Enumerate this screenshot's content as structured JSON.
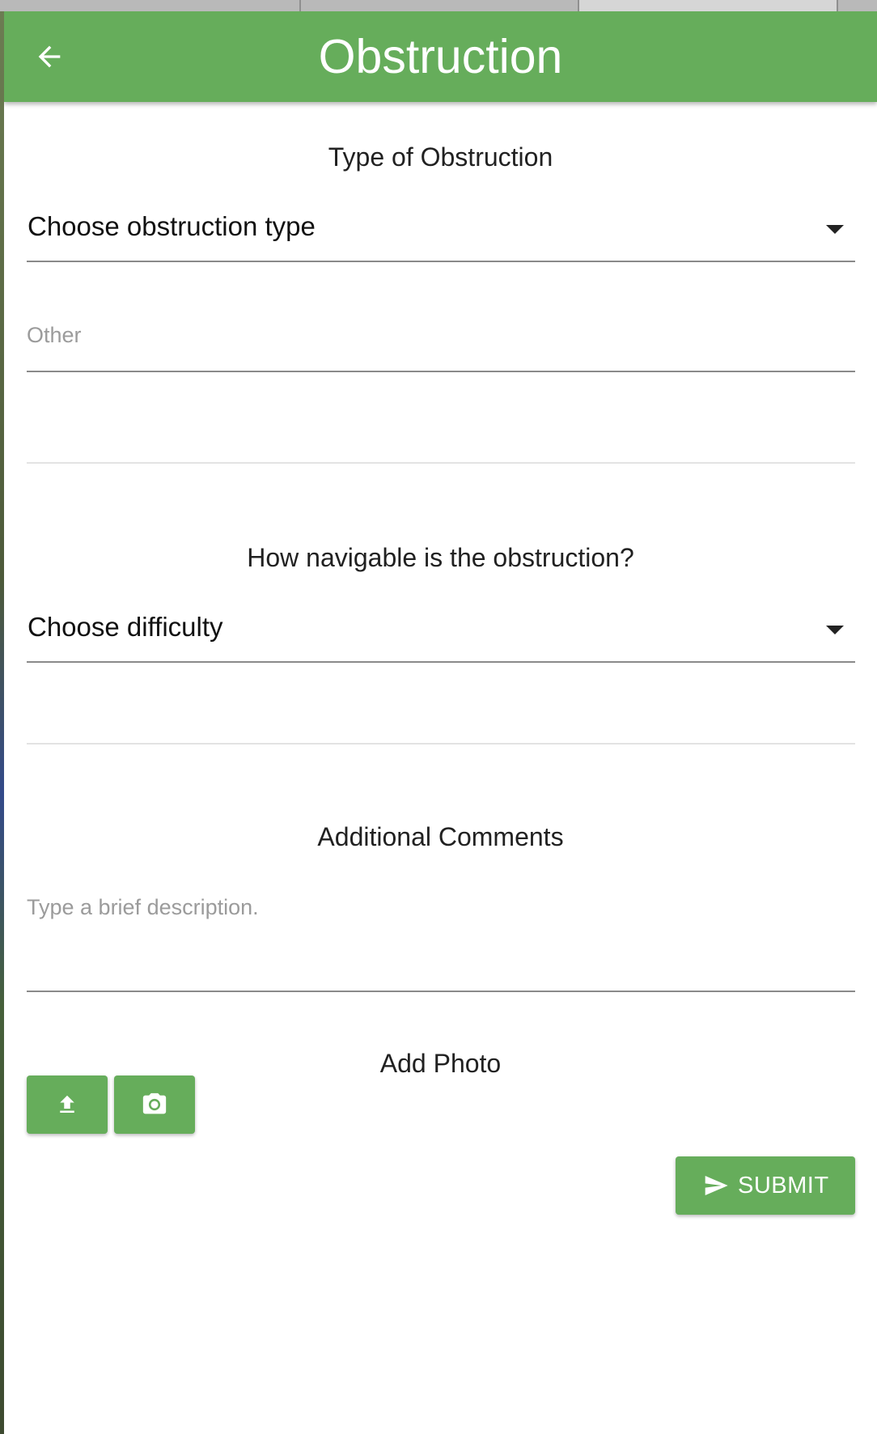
{
  "colors": {
    "primary": "#66ad5b",
    "on_primary": "#ffffff",
    "text": "#212121",
    "placeholder": "#9b9b9b",
    "underline": "#8a8a8a",
    "divider": "#e3e3e3"
  },
  "app_bar": {
    "title": "Obstruction",
    "back_icon": "arrow-back-icon"
  },
  "obstruction_type": {
    "heading": "Type of Obstruction",
    "select_value": "Choose obstruction type",
    "other_placeholder": "Other"
  },
  "difficulty": {
    "heading": "How navigable is the obstruction?",
    "select_value": "Choose difficulty"
  },
  "comments": {
    "heading": "Additional Comments",
    "placeholder": "Type a brief description."
  },
  "photo": {
    "heading": "Add Photo",
    "upload_icon": "upload-icon",
    "camera_icon": "camera-icon"
  },
  "submit": {
    "label": "SUBMIT",
    "icon": "send-icon"
  }
}
